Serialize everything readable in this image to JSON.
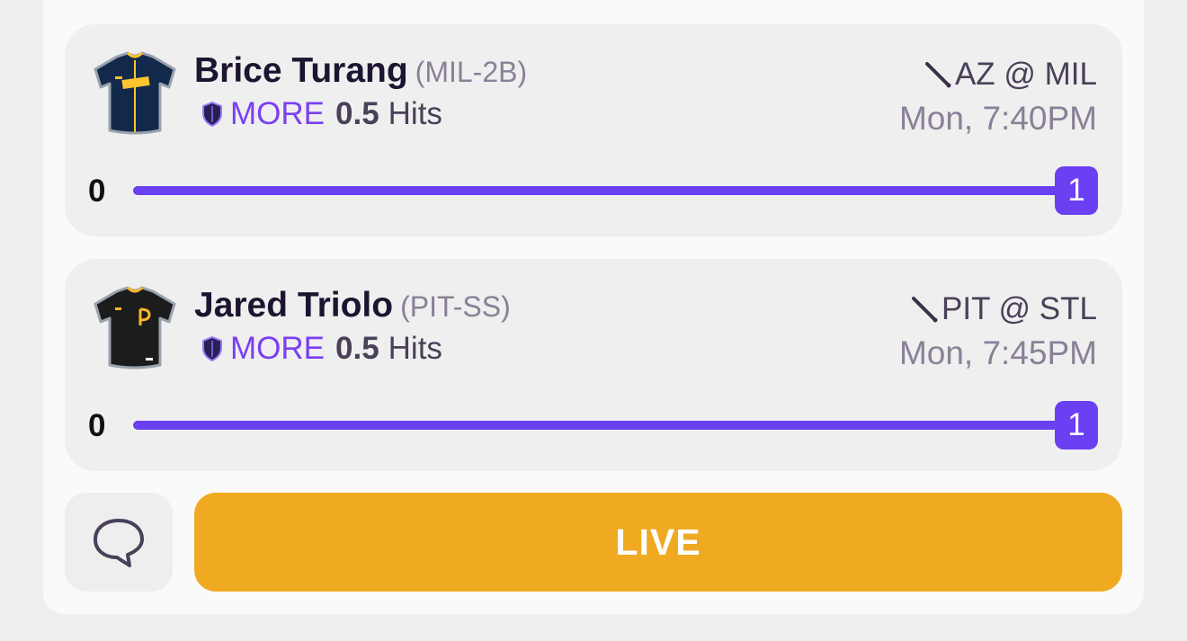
{
  "picks": [
    {
      "player": "Brice Turang",
      "position": "(MIL-2B)",
      "direction": "MORE",
      "line": "0.5",
      "stat": "Hits",
      "matchup": "AZ @ MIL",
      "time": "Mon, 7:40PM",
      "progress_start": "0",
      "progress_end": "1",
      "progress_fraction": 1.0,
      "jersey_icon": "milwaukee-jersey-icon",
      "jersey_colors": {
        "body": "#13294b",
        "trim": "#ffc52f"
      }
    },
    {
      "player": "Jared Triolo",
      "position": "(PIT-SS)",
      "direction": "MORE",
      "line": "0.5",
      "stat": "Hits",
      "matchup": "PIT @ STL",
      "time": "Mon, 7:45PM",
      "progress_start": "0",
      "progress_end": "1",
      "progress_fraction": 1.0,
      "jersey_icon": "pittsburgh-jersey-icon",
      "jersey_colors": {
        "body": "#1c1c1c",
        "trim": "#fdb827"
      }
    }
  ],
  "actions": {
    "chat_icon": "chat-bubble-icon",
    "live_label": "LIVE"
  },
  "colors": {
    "accent": "#6b3ff2",
    "live": "#efaa22",
    "card": "#efefef"
  }
}
